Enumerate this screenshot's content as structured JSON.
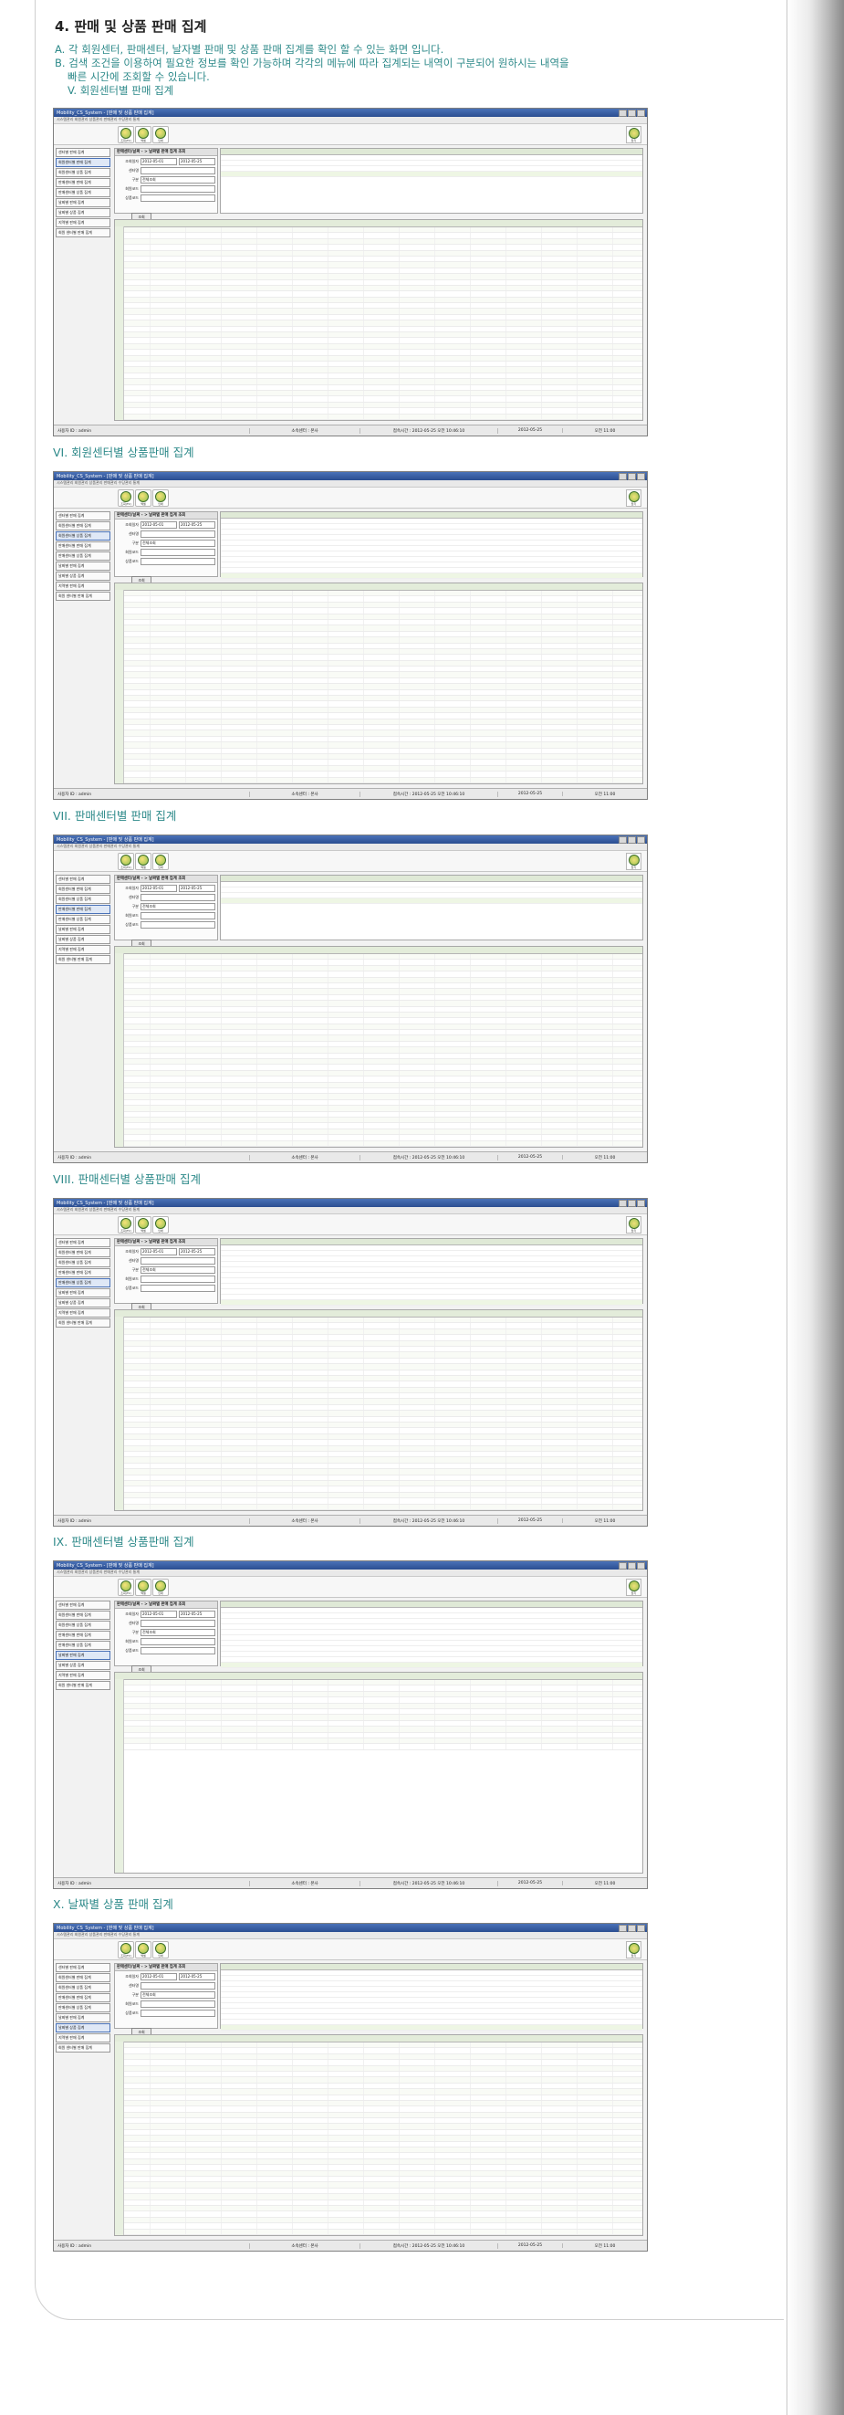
{
  "header": {
    "title": "4. 판매 및 상품 판매 집계",
    "line_a": "A. 각 회원센터, 판매센터, 날자별 판매 및 상품 판매 집계를 확인 할 수 있는 화면 입니다.",
    "line_b": "B. 검색 조건을 이용하여 필요한 정보를 확인 가능하며 각각의 메뉴에 따라 집계되는 내역이 구분되어 원하시는 내역을",
    "line_b2": "빠른 시간에 조회할 수 있습니다.",
    "section_v": "V. 회원센터별 판매 집계"
  },
  "sections": [
    {
      "title": "VI. 회원센터별 상품판매 집계"
    },
    {
      "title": "VII. 판매센터별 판매 집계"
    },
    {
      "title": "VIII.  판매센터별 상품판매 집계"
    },
    {
      "title": "IX. 판매센터별 상품판매 집계"
    },
    {
      "title": "X. 날짜별 상품 판매 집계"
    }
  ],
  "window": {
    "app_title": "Mobility_CS_System - [판매 및 상품 판매 집계]",
    "menu": "시스템관리  회원관리  상품관리  판매관리  수당관리  통계",
    "tool_buttons": [
      "조회(F2)",
      "엑셀",
      "인쇄"
    ],
    "exit_label": "닫기",
    "sidebar_items": [
      "센터별 판매 집계",
      "회원센터별 판매 집계",
      "회원센터별 상품 집계",
      "판매센터별 판매 집계",
      "판매센터별 상품 집계",
      "날짜별 판매 집계",
      "날짜별 상품 집계",
      "지역별 판매 집계",
      "회원 센터별 판매 집계"
    ],
    "form": {
      "head": "판매센터/날짜 - > 날짜별 판매 집계 조회",
      "date_label": "조회일자",
      "date_from": "2012-05-01",
      "date_to": "2012-05-25",
      "center_label": "센터명",
      "type_label": "구분",
      "type_value": "전체조회",
      "member_label": "회원코드",
      "product_label": "상품코드",
      "search_button": "조회"
    },
    "status": {
      "user": "사용자 ID : admin",
      "center": "소속센터 : 본사",
      "login": "접속시간 : 2012-05-25 오전 10:46:10",
      "date": "2012-05-25",
      "time": "오전 11:00"
    }
  }
}
